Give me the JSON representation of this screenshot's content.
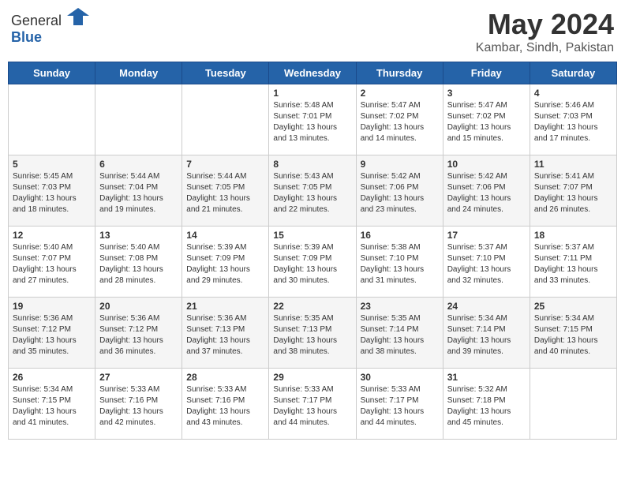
{
  "header": {
    "logo_general": "General",
    "logo_blue": "Blue",
    "title": "May 2024",
    "location": "Kambar, Sindh, Pakistan"
  },
  "days_of_week": [
    "Sunday",
    "Monday",
    "Tuesday",
    "Wednesday",
    "Thursday",
    "Friday",
    "Saturday"
  ],
  "weeks": [
    [
      {
        "day": "",
        "info": ""
      },
      {
        "day": "",
        "info": ""
      },
      {
        "day": "",
        "info": ""
      },
      {
        "day": "1",
        "info": "Sunrise: 5:48 AM\nSunset: 7:01 PM\nDaylight: 13 hours\nand 13 minutes."
      },
      {
        "day": "2",
        "info": "Sunrise: 5:47 AM\nSunset: 7:02 PM\nDaylight: 13 hours\nand 14 minutes."
      },
      {
        "day": "3",
        "info": "Sunrise: 5:47 AM\nSunset: 7:02 PM\nDaylight: 13 hours\nand 15 minutes."
      },
      {
        "day": "4",
        "info": "Sunrise: 5:46 AM\nSunset: 7:03 PM\nDaylight: 13 hours\nand 17 minutes."
      }
    ],
    [
      {
        "day": "5",
        "info": "Sunrise: 5:45 AM\nSunset: 7:03 PM\nDaylight: 13 hours\nand 18 minutes."
      },
      {
        "day": "6",
        "info": "Sunrise: 5:44 AM\nSunset: 7:04 PM\nDaylight: 13 hours\nand 19 minutes."
      },
      {
        "day": "7",
        "info": "Sunrise: 5:44 AM\nSunset: 7:05 PM\nDaylight: 13 hours\nand 21 minutes."
      },
      {
        "day": "8",
        "info": "Sunrise: 5:43 AM\nSunset: 7:05 PM\nDaylight: 13 hours\nand 22 minutes."
      },
      {
        "day": "9",
        "info": "Sunrise: 5:42 AM\nSunset: 7:06 PM\nDaylight: 13 hours\nand 23 minutes."
      },
      {
        "day": "10",
        "info": "Sunrise: 5:42 AM\nSunset: 7:06 PM\nDaylight: 13 hours\nand 24 minutes."
      },
      {
        "day": "11",
        "info": "Sunrise: 5:41 AM\nSunset: 7:07 PM\nDaylight: 13 hours\nand 26 minutes."
      }
    ],
    [
      {
        "day": "12",
        "info": "Sunrise: 5:40 AM\nSunset: 7:07 PM\nDaylight: 13 hours\nand 27 minutes."
      },
      {
        "day": "13",
        "info": "Sunrise: 5:40 AM\nSunset: 7:08 PM\nDaylight: 13 hours\nand 28 minutes."
      },
      {
        "day": "14",
        "info": "Sunrise: 5:39 AM\nSunset: 7:09 PM\nDaylight: 13 hours\nand 29 minutes."
      },
      {
        "day": "15",
        "info": "Sunrise: 5:39 AM\nSunset: 7:09 PM\nDaylight: 13 hours\nand 30 minutes."
      },
      {
        "day": "16",
        "info": "Sunrise: 5:38 AM\nSunset: 7:10 PM\nDaylight: 13 hours\nand 31 minutes."
      },
      {
        "day": "17",
        "info": "Sunrise: 5:37 AM\nSunset: 7:10 PM\nDaylight: 13 hours\nand 32 minutes."
      },
      {
        "day": "18",
        "info": "Sunrise: 5:37 AM\nSunset: 7:11 PM\nDaylight: 13 hours\nand 33 minutes."
      }
    ],
    [
      {
        "day": "19",
        "info": "Sunrise: 5:36 AM\nSunset: 7:12 PM\nDaylight: 13 hours\nand 35 minutes."
      },
      {
        "day": "20",
        "info": "Sunrise: 5:36 AM\nSunset: 7:12 PM\nDaylight: 13 hours\nand 36 minutes."
      },
      {
        "day": "21",
        "info": "Sunrise: 5:36 AM\nSunset: 7:13 PM\nDaylight: 13 hours\nand 37 minutes."
      },
      {
        "day": "22",
        "info": "Sunrise: 5:35 AM\nSunset: 7:13 PM\nDaylight: 13 hours\nand 38 minutes."
      },
      {
        "day": "23",
        "info": "Sunrise: 5:35 AM\nSunset: 7:14 PM\nDaylight: 13 hours\nand 38 minutes."
      },
      {
        "day": "24",
        "info": "Sunrise: 5:34 AM\nSunset: 7:14 PM\nDaylight: 13 hours\nand 39 minutes."
      },
      {
        "day": "25",
        "info": "Sunrise: 5:34 AM\nSunset: 7:15 PM\nDaylight: 13 hours\nand 40 minutes."
      }
    ],
    [
      {
        "day": "26",
        "info": "Sunrise: 5:34 AM\nSunset: 7:15 PM\nDaylight: 13 hours\nand 41 minutes."
      },
      {
        "day": "27",
        "info": "Sunrise: 5:33 AM\nSunset: 7:16 PM\nDaylight: 13 hours\nand 42 minutes."
      },
      {
        "day": "28",
        "info": "Sunrise: 5:33 AM\nSunset: 7:16 PM\nDaylight: 13 hours\nand 43 minutes."
      },
      {
        "day": "29",
        "info": "Sunrise: 5:33 AM\nSunset: 7:17 PM\nDaylight: 13 hours\nand 44 minutes."
      },
      {
        "day": "30",
        "info": "Sunrise: 5:33 AM\nSunset: 7:17 PM\nDaylight: 13 hours\nand 44 minutes."
      },
      {
        "day": "31",
        "info": "Sunrise: 5:32 AM\nSunset: 7:18 PM\nDaylight: 13 hours\nand 45 minutes."
      },
      {
        "day": "",
        "info": ""
      }
    ]
  ]
}
